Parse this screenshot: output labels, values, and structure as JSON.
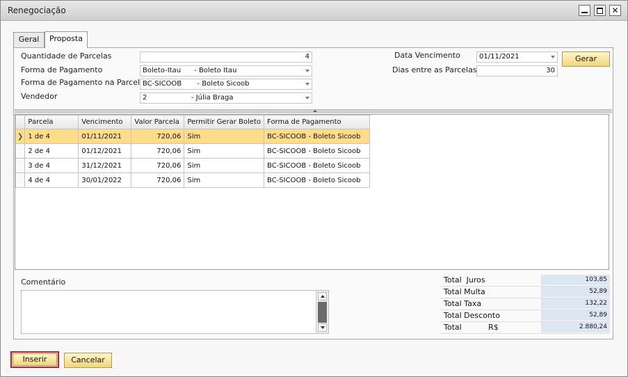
{
  "window": {
    "title": "Renegociação"
  },
  "tabs": [
    {
      "label": "Geral",
      "active": false
    },
    {
      "label": "Proposta",
      "active": true
    }
  ],
  "form": {
    "quantidade_label": "Quantidade de Parcelas",
    "quantidade_value": "4",
    "forma_pagamento_label": "Forma de Pagamento",
    "forma_pagamento_value": "Boleto-Itau      - Boleto Itau",
    "forma_parcela_label": "Forma de Pagamento na Parcela",
    "forma_parcela_value": "BC-SICOOB       - Boleto Sicoob",
    "vendedor_label": "Vendedor",
    "vendedor_value": "2                    - Júlia Braga",
    "data_vencimento_label": "Data Vencimento",
    "data_vencimento_value": "01/11/2021",
    "dias_label": "Dias entre as Parcelas",
    "dias_value": "30",
    "gerar_label": "Gerar"
  },
  "grid": {
    "columns": [
      "Parcela",
      "Vencimento",
      "Valor Parcela",
      "Permitir Gerar Boleto",
      "Forma de Pagamento"
    ],
    "rows": [
      {
        "parcela": "1 de 4",
        "vencimento": "01/11/2021",
        "valor": "720,06",
        "permitir": "Sim",
        "forma": "BC-SICOOB - Boleto Sicoob"
      },
      {
        "parcela": "2 de 4",
        "vencimento": "01/12/2021",
        "valor": "720,06",
        "permitir": "Sim",
        "forma": "BC-SICOOB - Boleto Sicoob"
      },
      {
        "parcela": "3 de 4",
        "vencimento": "31/12/2021",
        "valor": "720,06",
        "permitir": "Sim",
        "forma": "BC-SICOOB - Boleto Sicoob"
      },
      {
        "parcela": "4 de 4",
        "vencimento": "30/01/2022",
        "valor": "720,06",
        "permitir": "Sim",
        "forma": "BC-SICOOB - Boleto Sicoob"
      }
    ],
    "selected_row_marker": "❯"
  },
  "comment": {
    "label": "Comentário"
  },
  "totals": [
    {
      "label": "Total  Juros",
      "value": "103,85"
    },
    {
      "label": "Total Multa",
      "value": "52,89"
    },
    {
      "label": "Total Taxa",
      "value": "132,22"
    },
    {
      "label": "Total Desconto",
      "value": "52,89"
    },
    {
      "label": "Total           R$",
      "value": "2.880,24"
    }
  ],
  "buttons": {
    "inserir": "Inserir",
    "cancelar": "Cancelar"
  },
  "colors": {
    "selected_row": "#fddc8a",
    "button": "#f1d77c",
    "highlight_border": "#e0121b",
    "totals_bg": "#dde7f3"
  }
}
